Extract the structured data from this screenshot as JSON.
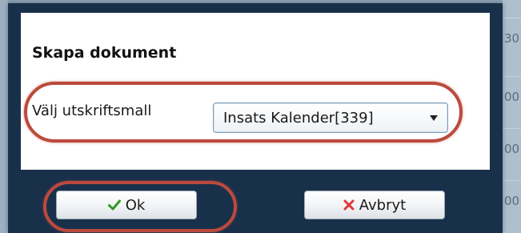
{
  "background": {
    "right_cells": [
      "30",
      "00",
      "00",
      "00"
    ]
  },
  "dialog": {
    "title": "Skapa dokument",
    "template_label": "Välj utskriftsmall",
    "template_select": {
      "selected": "Insats Kalender[339]",
      "icon": "chevron-down-icon"
    },
    "ok_button": {
      "label": "Ok",
      "icon": "checkmark-icon",
      "icon_color": "#2a9a1e"
    },
    "cancel_button": {
      "label": "Avbryt",
      "icon": "x-icon",
      "icon_color": "#e0373b"
    }
  },
  "colors": {
    "dialog_frame": "#19304a",
    "annotation_ring": "#bb4a3e"
  }
}
